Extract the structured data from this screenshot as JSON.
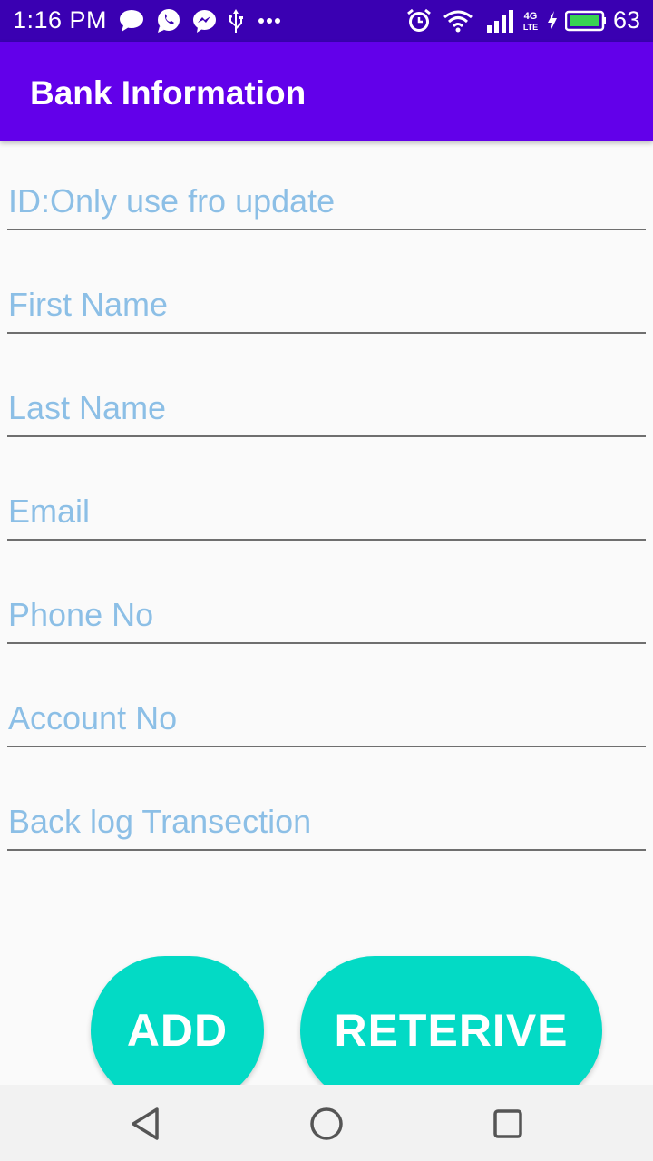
{
  "status_bar": {
    "time": "1:16 PM",
    "battery_level": "63",
    "icons": [
      "chat-bubble-icon",
      "whatsapp-icon",
      "messenger-icon",
      "usb-icon",
      "more-dots-icon",
      "alarm-icon",
      "wifi-icon",
      "signal-icon",
      "lte-icon",
      "charging-icon",
      "battery-icon"
    ]
  },
  "app_bar": {
    "title": "Bank Information"
  },
  "form": {
    "id_placeholder": "ID:Only use fro update",
    "first_name_placeholder": "First Name",
    "last_name_placeholder": "Last Name",
    "email_placeholder": "Email",
    "phone_placeholder": "Phone No",
    "account_placeholder": "Account No",
    "backlog_placeholder": "Back log Transection"
  },
  "buttons": {
    "add_label": "ADD",
    "retrieve_label": "RETERIVE"
  },
  "nav_bar": {
    "icons": [
      "back-icon",
      "home-icon",
      "recents-icon"
    ]
  },
  "colors": {
    "status_bar": "#3a00b2",
    "app_bar": "#6200ea",
    "accent": "#03dac5",
    "hint_text": "#8cbfe6"
  }
}
